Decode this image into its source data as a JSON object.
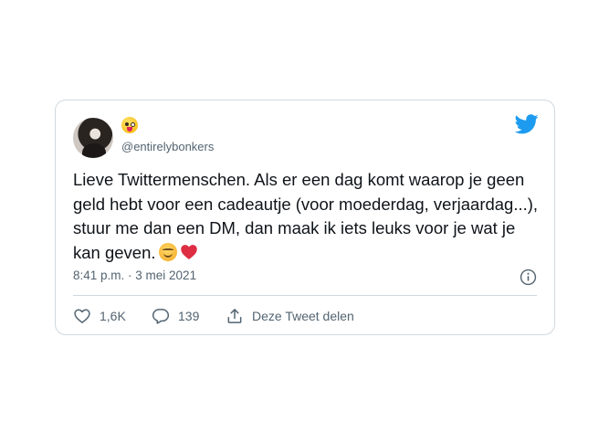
{
  "tweet": {
    "handle": "@entirelybonkers",
    "text": "Lieve Twittermenschen. Als er een dag komt waarop je geen geld hebt voor een cadeautje (voor moederdag, verjaardag...), stuur me dan een DM, dan maak ik iets leuks voor je wat je kan geven.",
    "timestamp": "8:41 p.m. · 3 mei 2021",
    "name_emoji": "zany-face-emoji",
    "text_emojis": [
      "smiling-face-emoji",
      "red-heart-emoji"
    ]
  },
  "actions": {
    "likes": "1,6K",
    "replies": "139",
    "share_label": "Deze Tweet delen"
  },
  "colors": {
    "twitter_blue": "#1d9bf0",
    "secondary_text": "#536471",
    "border": "#cfd9de",
    "heart_red": "#e0245e"
  }
}
